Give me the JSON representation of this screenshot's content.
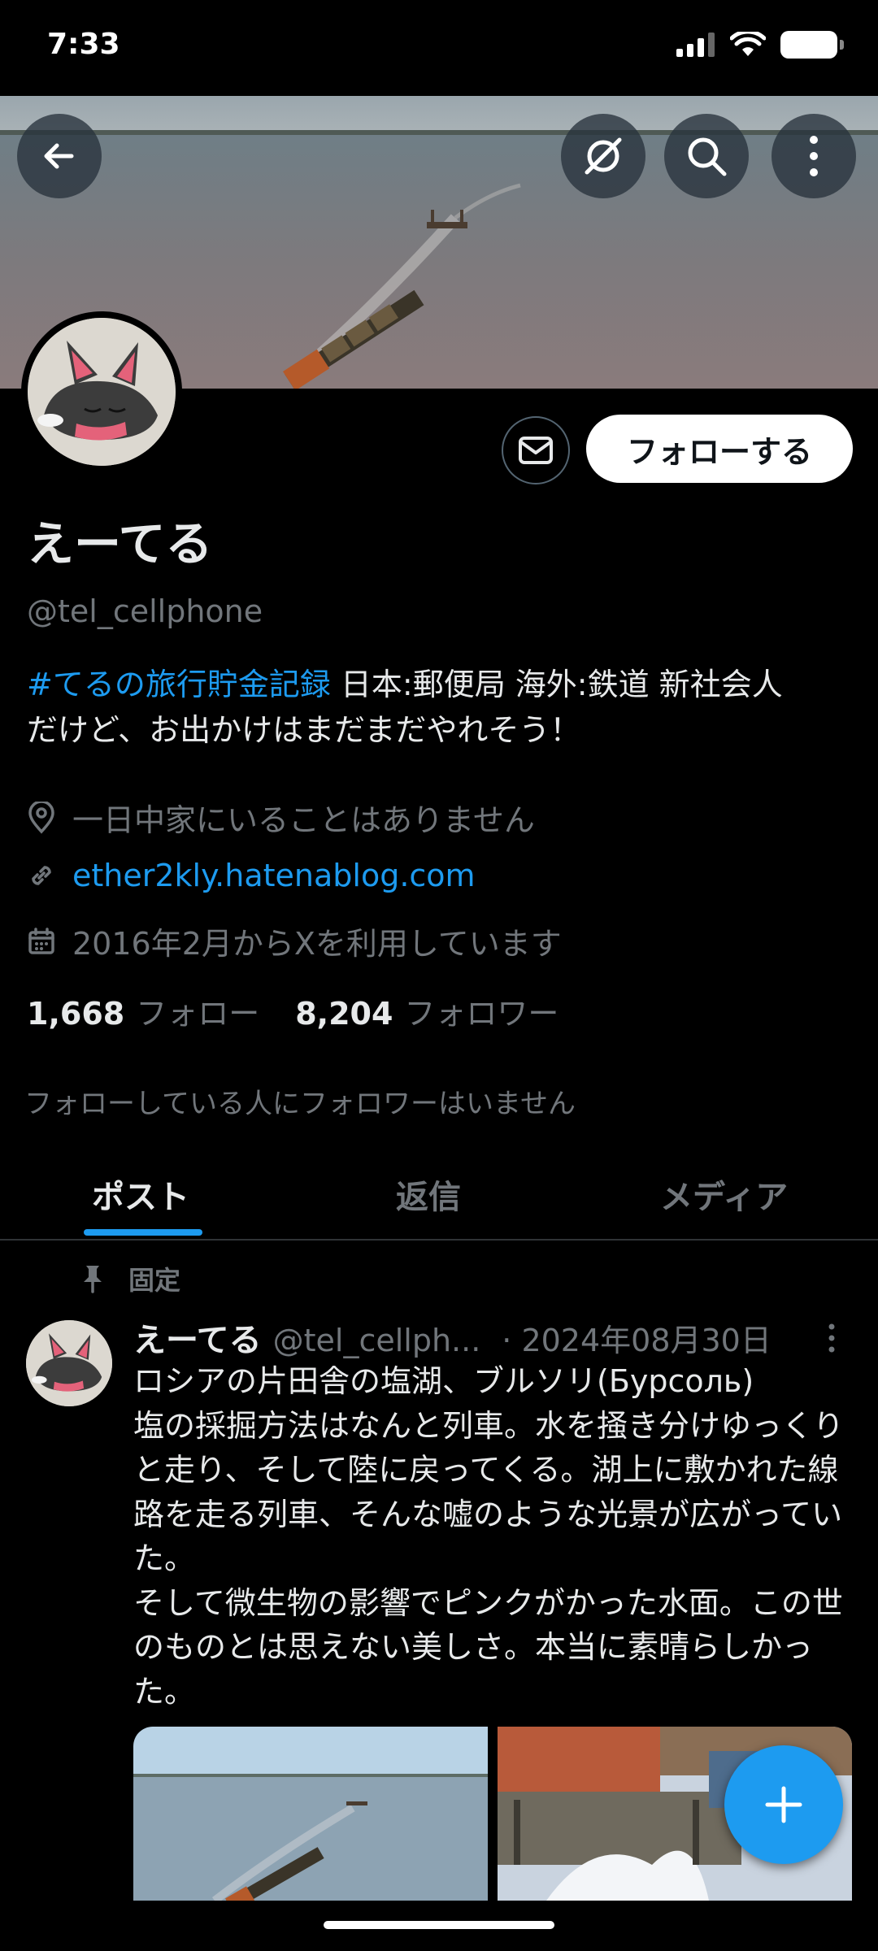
{
  "status_bar": {
    "time": "7:33"
  },
  "profile": {
    "display_name": "えーてる",
    "handle": "@tel_cellphone",
    "bio_hashtag": "#てるの旅行貯金記録",
    "bio_line1_rest": " 日本:郵便局 海外:鉄道 新社会人",
    "bio_line2": "だけど、お出かけはまだまだやれそう！",
    "location": "一日中家にいることはありません",
    "website": "ether2kly.hatenablog.com",
    "joined": "2016年2月からXを利用しています",
    "following_count": "1,668",
    "following_label": "フォロー",
    "followers_count": "8,204",
    "followers_label": "フォロワー",
    "followers_you_know": "フォローしている人にフォロワーはいません"
  },
  "actions": {
    "follow_label": "フォローする"
  },
  "tabs": [
    {
      "label": "ポスト",
      "active": true
    },
    {
      "label": "返信",
      "active": false
    },
    {
      "label": "メディア",
      "active": false
    }
  ],
  "pinned_post": {
    "pinned_label": "固定",
    "author_name": "えーてる",
    "author_handle": "@tel_cellph...",
    "date": "· 2024年08月30日",
    "text": "ロシアの片田舎の塩湖、ブルソリ(Бурсоль)\n塩の採掘方法はなんと列車。水を掻き分けゆっくりと走り、そして陸に戻ってくる。湖上に敷かれた線路を走る列車、そんな嘘のような光景が広がっていた。\nそして微生物の影響でピンクがかった水面。この世のものとは思えない美しさ。本当に素晴らしかった。"
  },
  "icons": {
    "back": "arrow-left-icon",
    "grok": "grok-icon",
    "search": "search-icon",
    "more": "more-vertical-icon",
    "mail": "mail-icon",
    "location": "location-pin-icon",
    "link": "link-icon",
    "calendar": "calendar-icon",
    "pin": "pin-icon",
    "compose": "plus-icon"
  },
  "colors": {
    "accent": "#1d9bf0",
    "background": "#000000",
    "secondary_text": "#71767b",
    "primary_text": "#e7e9ea"
  }
}
